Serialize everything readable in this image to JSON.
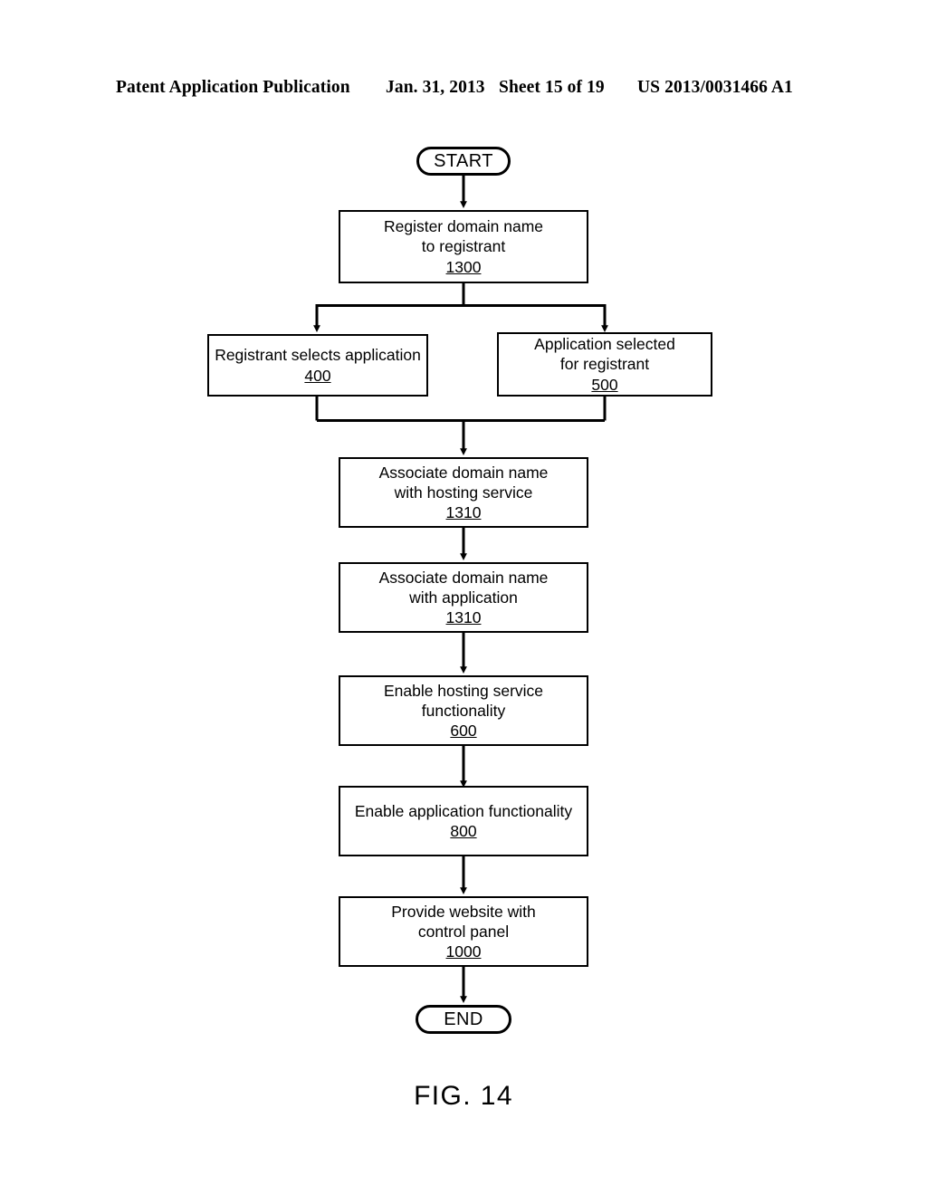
{
  "header": {
    "publication": "Patent Application Publication",
    "date": "Jan. 31, 2013",
    "sheet": "Sheet 15 of 19",
    "patent_number": "US 2013/0031466 A1"
  },
  "figure": {
    "caption": "FIG. 14",
    "type": "flowchart"
  },
  "flow": {
    "start": {
      "label": "START"
    },
    "end": {
      "label": "END"
    },
    "nodes": [
      {
        "id": "register",
        "lines": [
          "Register domain name",
          "to registrant"
        ],
        "ref": "1300"
      },
      {
        "id": "registrant-selects",
        "lines": [
          "Registrant selects application"
        ],
        "ref": "400"
      },
      {
        "id": "application-selected",
        "lines": [
          "Application selected",
          "for registrant"
        ],
        "ref": "500"
      },
      {
        "id": "associate-hosting",
        "lines": [
          "Associate domain name",
          "with hosting service"
        ],
        "ref": "1310"
      },
      {
        "id": "associate-application",
        "lines": [
          "Associate domain name",
          "with application"
        ],
        "ref": "1310"
      },
      {
        "id": "enable-hosting",
        "lines": [
          "Enable hosting service",
          "functionality"
        ],
        "ref": "600"
      },
      {
        "id": "enable-application",
        "lines": [
          "Enable application functionality"
        ],
        "ref": "800"
      },
      {
        "id": "provide-website",
        "lines": [
          "Provide website with",
          "control panel"
        ],
        "ref": "1000"
      }
    ],
    "colors": {
      "stroke": "#000000",
      "fill": "#ffffff"
    }
  }
}
